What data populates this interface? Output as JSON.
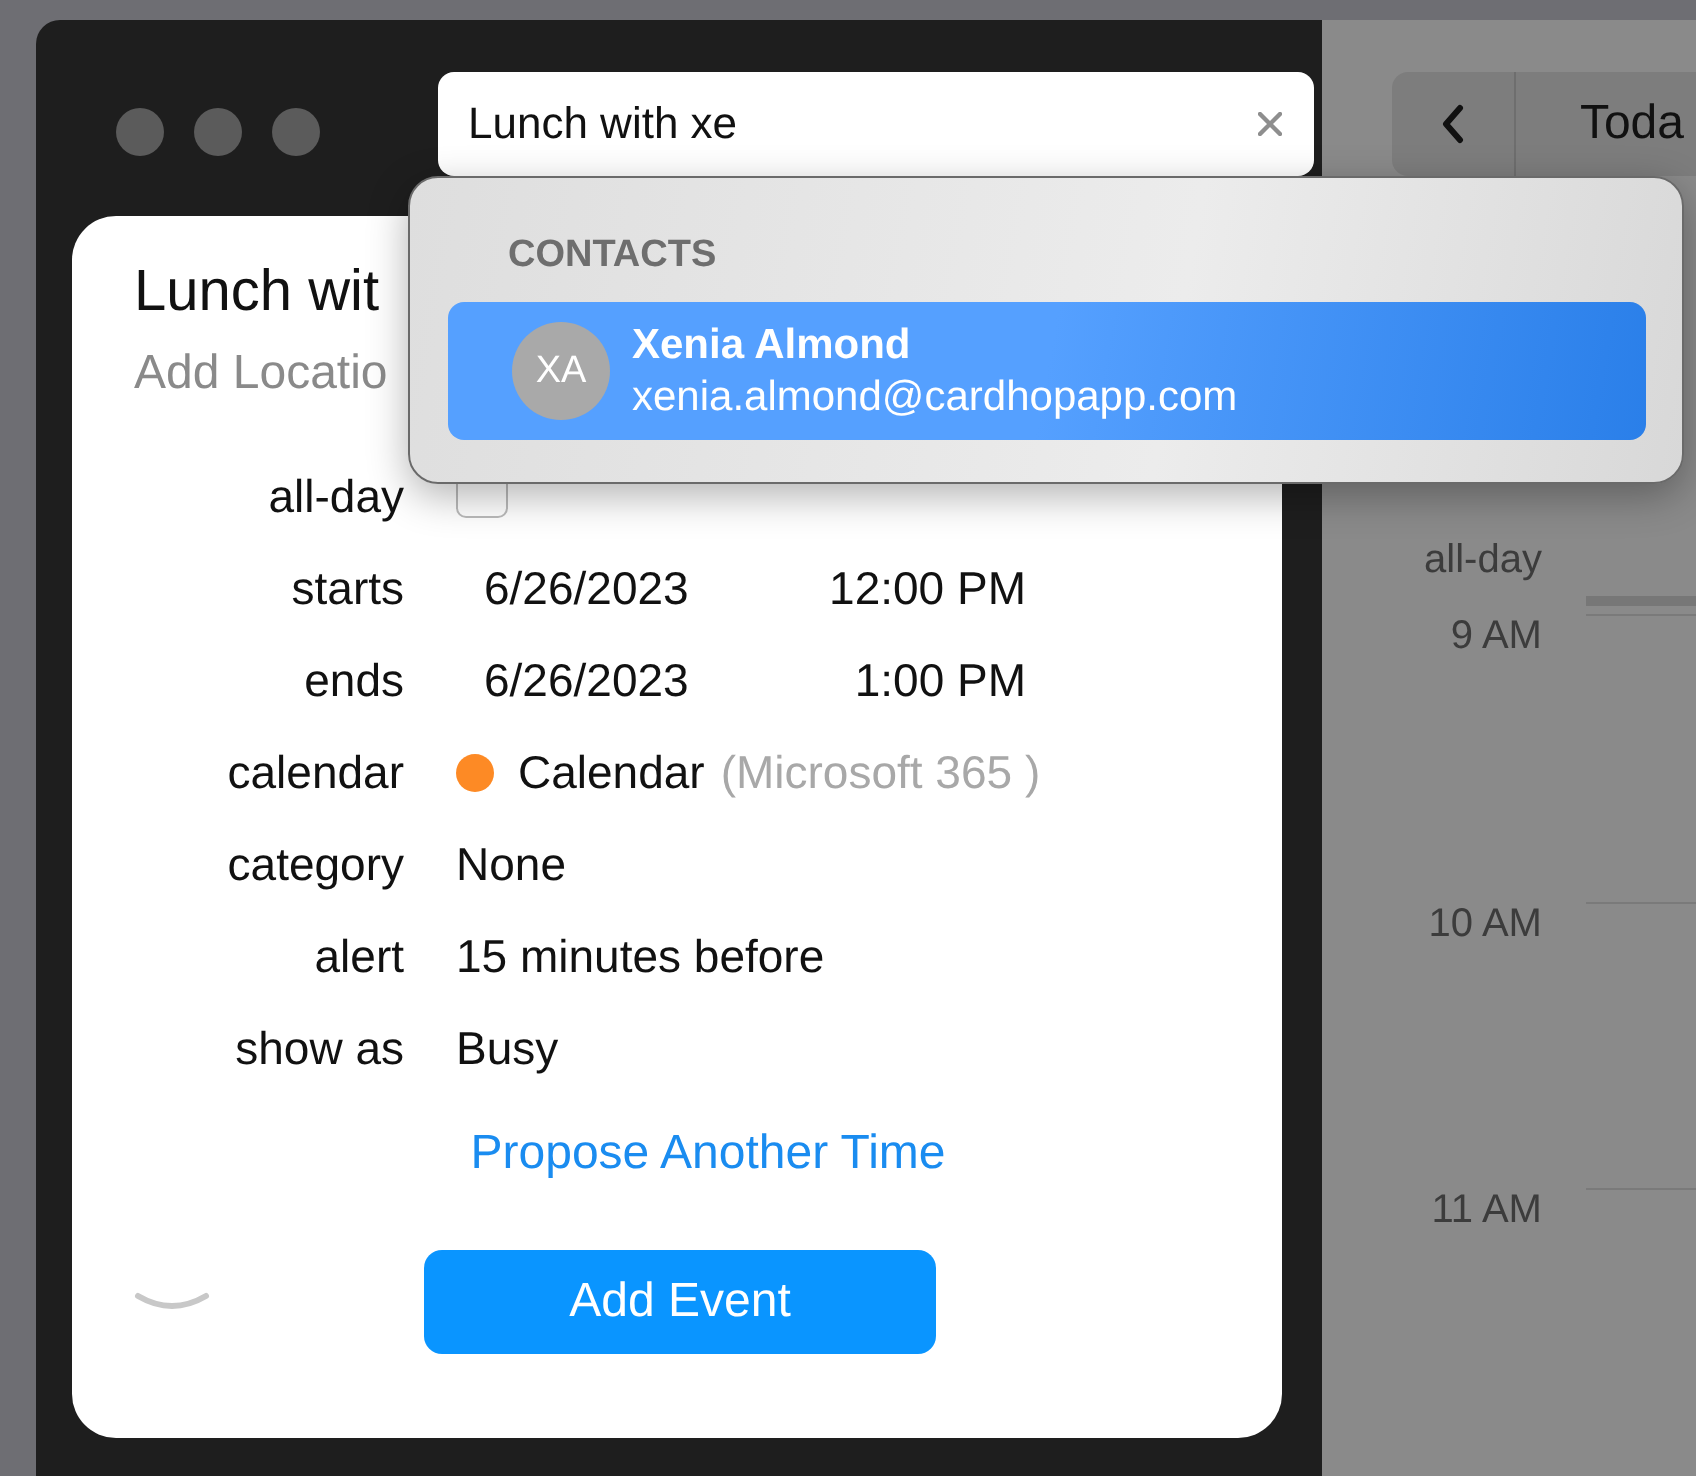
{
  "search": {
    "value": "Lunch with xe"
  },
  "suggestions": {
    "section": "CONTACTS",
    "items": [
      {
        "initials": "XA",
        "name": "Xenia Almond",
        "email": "xenia.almond@cardhopapp.com",
        "selected": true
      }
    ]
  },
  "event": {
    "title": "Lunch wit",
    "location_placeholder": "Add Locatio",
    "all_day": {
      "label": "all-day",
      "checked": false
    },
    "fields": [
      {
        "kind": "datetime",
        "label": "starts",
        "date": "6/26/2023",
        "time": "12:00 PM"
      },
      {
        "kind": "datetime",
        "label": "ends",
        "date": "6/26/2023",
        "time": "1:00 PM"
      },
      {
        "kind": "calendar",
        "label": "calendar",
        "name": "Calendar",
        "account": "(Microsoft 365 )",
        "color": "#fd8a25"
      },
      {
        "kind": "text",
        "label": "category",
        "value": "None"
      },
      {
        "kind": "text",
        "label": "alert",
        "value": "15 minutes before"
      },
      {
        "kind": "text",
        "label": "show as",
        "value": "Busy"
      }
    ],
    "link": "Propose Another Time",
    "button": "Add Event"
  },
  "calendar_view": {
    "nav_label": "Toda",
    "all_day_label": "all-day",
    "hours": [
      "9 AM",
      "10 AM",
      "11 AM"
    ]
  }
}
